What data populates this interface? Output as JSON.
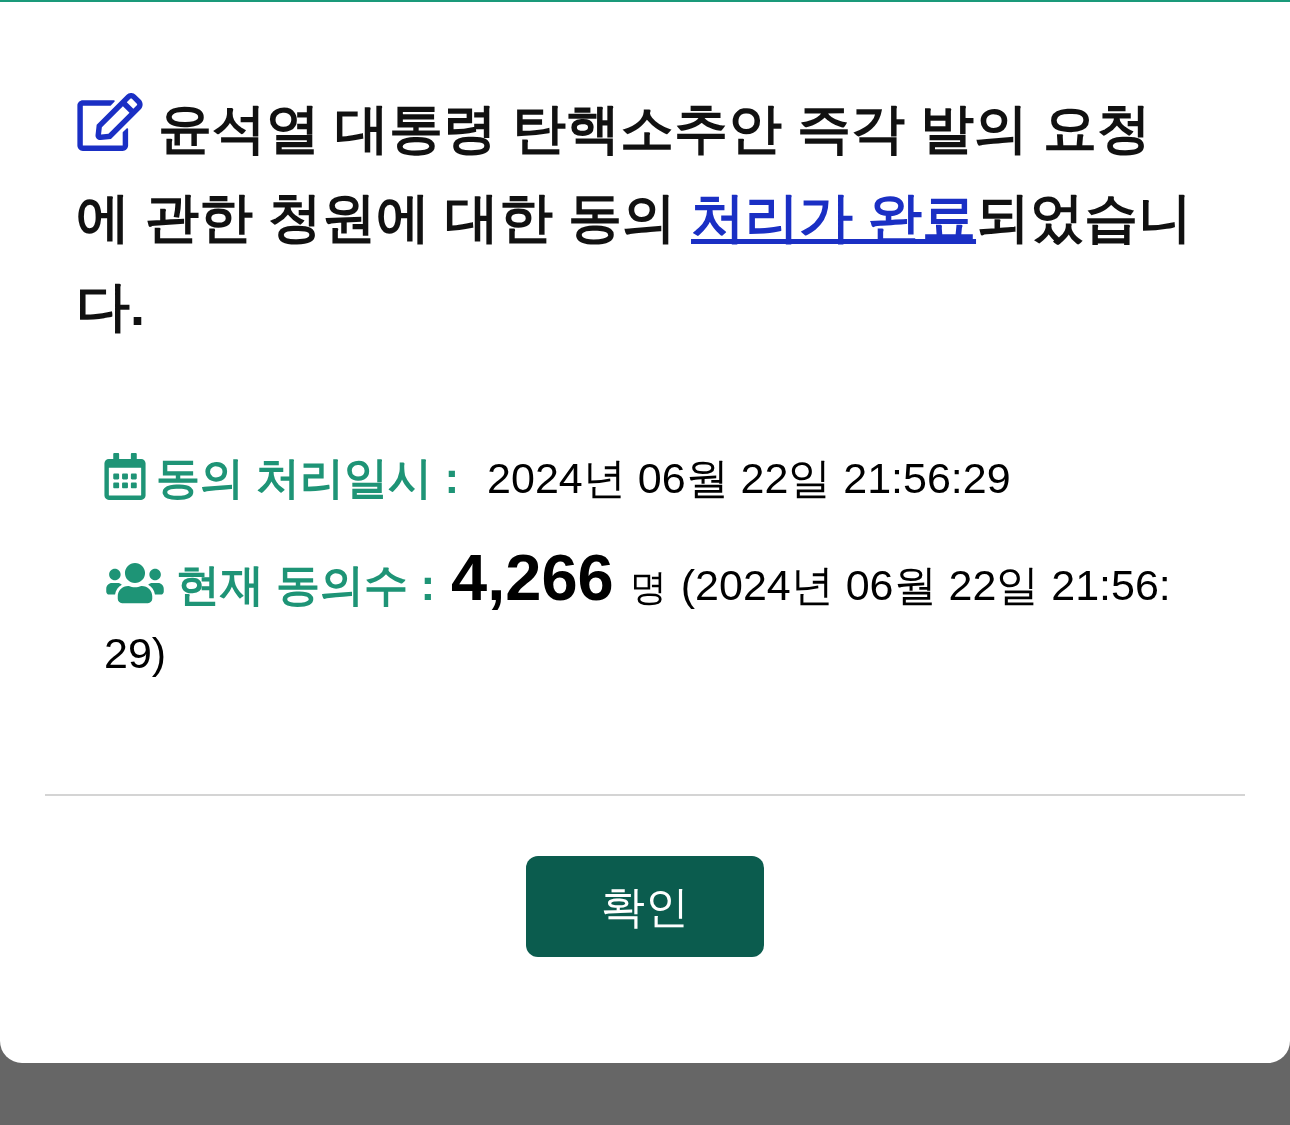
{
  "dialog": {
    "title": {
      "text_before": "윤석열 대통령 탄핵소추안 즉각 발의 요청에 관한 청원에 대한 동의 ",
      "link": "처리가 완료",
      "text_after": "되었습니다."
    },
    "details": [
      {
        "kind": "datetime",
        "label": "동의 처리일시 :",
        "value": "2024년 06월 22일 21:56:29"
      },
      {
        "kind": "count",
        "label": "현재 동의수 :",
        "count": "4,266",
        "unit": "명",
        "note": "(2024년 06월 22일 21:56:29)"
      }
    ],
    "buttons": [
      {
        "label": "확인"
      }
    ]
  }
}
